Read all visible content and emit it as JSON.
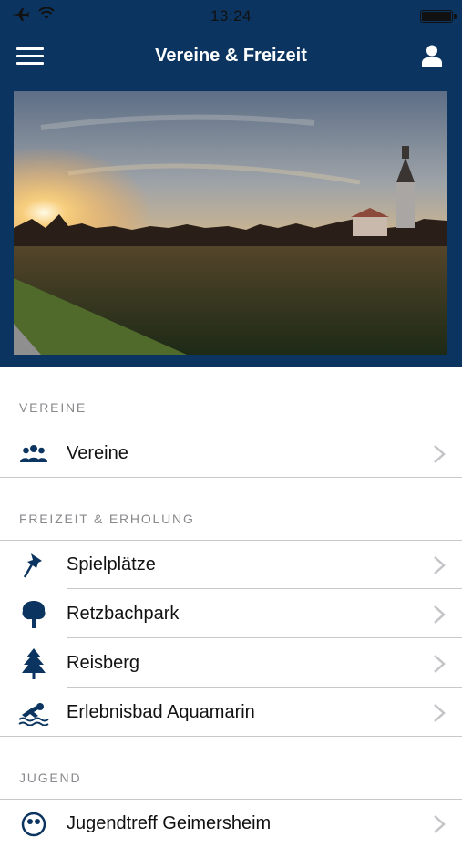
{
  "statusbar": {
    "time": "13:24"
  },
  "navbar": {
    "title": "Vereine & Freizeit"
  },
  "sections": [
    {
      "header": "VEREINE",
      "items": [
        {
          "label": "Vereine",
          "icon": "group-icon"
        }
      ]
    },
    {
      "header": "FREIZEIT & ERHOLUNG",
      "items": [
        {
          "label": "Spielplätze",
          "icon": "pushpin-icon"
        },
        {
          "label": "Retzbachpark",
          "icon": "tree-icon"
        },
        {
          "label": "Reisberg",
          "icon": "pine-tree-icon"
        },
        {
          "label": "Erlebnisbad Aquamarin",
          "icon": "swimmer-icon"
        }
      ]
    },
    {
      "header": "JUGEND",
      "items": [
        {
          "label": "Jugendtreff Geimersheim",
          "icon": "youth-icon"
        }
      ]
    }
  ],
  "colors": {
    "header_bg": "#0b3560",
    "icon": "#0b3560",
    "section_text": "#8a8a8e"
  }
}
